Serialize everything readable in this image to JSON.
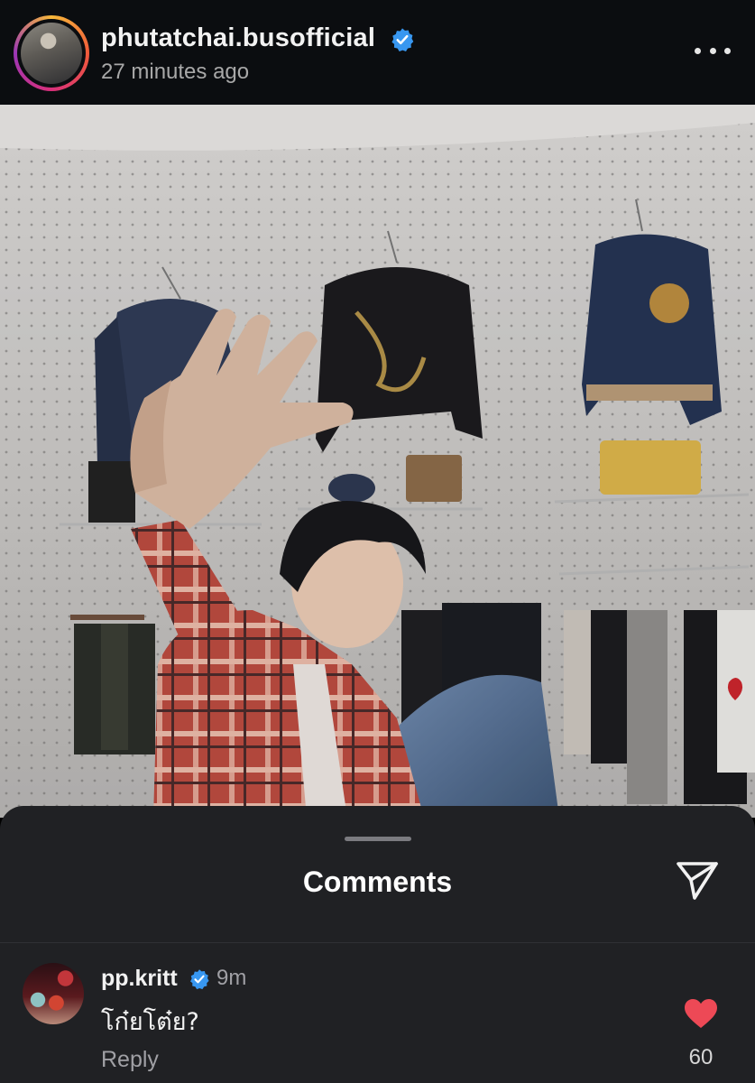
{
  "header": {
    "username": "phutatchai.busofficial",
    "timestamp": "27 minutes ago",
    "more_icon": "more-horizontal-icon"
  },
  "post": {
    "image_description_icon": "post-photo"
  },
  "comments_sheet": {
    "title": "Comments",
    "share_icon": "paper-plane-icon",
    "comments": [
      {
        "username": "pp.kritt",
        "verified": true,
        "time": "9m",
        "text": "โก๋ยโต๋ย?",
        "reply_label": "Reply",
        "likes": "60",
        "liked": true
      }
    ]
  },
  "colors": {
    "verified_blue": "#3897f0",
    "like_red": "#ed4956",
    "sheet_bg": "#202124",
    "header_bg": "#0b0d10"
  }
}
